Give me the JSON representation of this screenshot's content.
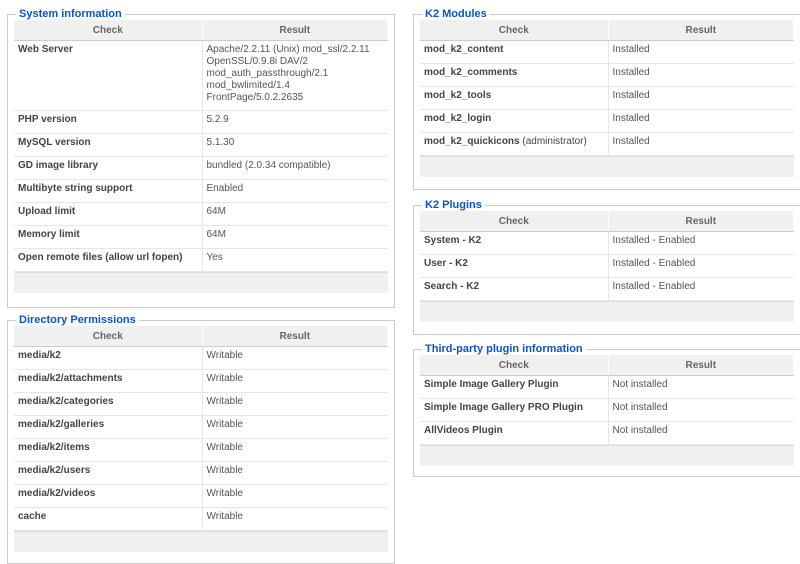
{
  "headers": {
    "check": "Check",
    "result": "Result"
  },
  "system": {
    "title": "System information",
    "rows": [
      {
        "check": "Web Server",
        "lines": [
          "Apache/2.2.11 (Unix) mod_ssl/2.2.11",
          "OpenSSL/0.9.8i DAV/2",
          "mod_auth_passthrough/2.1",
          "mod_bwlimited/1.4",
          "FrontPage/5.0.2.2635"
        ]
      },
      {
        "check": "PHP version",
        "result": "5.2.9"
      },
      {
        "check": "MySQL version",
        "result": "5.1.30"
      },
      {
        "check": "GD image library",
        "result": "bundled (2.0.34 compatible)"
      },
      {
        "check": "Multibyte string support",
        "result": "Enabled"
      },
      {
        "check": "Upload limit",
        "result": "64M"
      },
      {
        "check": "Memory limit",
        "result": "64M"
      },
      {
        "check": "Open remote files (allow url fopen)",
        "result": "Yes"
      }
    ]
  },
  "directory": {
    "title": "Directory Permissions",
    "rows": [
      {
        "check": "media/k2",
        "result": "Writable"
      },
      {
        "check": "media/k2/attachments",
        "result": "Writable"
      },
      {
        "check": "media/k2/categories",
        "result": "Writable"
      },
      {
        "check": "media/k2/galleries",
        "result": "Writable"
      },
      {
        "check": "media/k2/items",
        "result": "Writable"
      },
      {
        "check": "media/k2/users",
        "result": "Writable"
      },
      {
        "check": "media/k2/videos",
        "result": "Writable"
      },
      {
        "check": "cache",
        "result": "Writable"
      }
    ]
  },
  "modules": {
    "title": "K2 Modules",
    "rows": [
      {
        "check": "mod_k2_content",
        "result": "Installed"
      },
      {
        "check": "mod_k2_comments",
        "result": "Installed"
      },
      {
        "check": "mod_k2_tools",
        "result": "Installed"
      },
      {
        "check": "mod_k2_login",
        "result": "Installed"
      },
      {
        "check": "mod_k2_quickicons",
        "suffix": " (administrator)",
        "result": "Installed"
      }
    ]
  },
  "plugins": {
    "title": "K2 Plugins",
    "rows": [
      {
        "check": "System - K2",
        "result": "Installed - Enabled"
      },
      {
        "check": "User - K2",
        "result": "Installed - Enabled"
      },
      {
        "check": "Search - K2",
        "result": "Installed - Enabled"
      }
    ]
  },
  "thirdparty": {
    "title": "Third-party plugin information",
    "rows": [
      {
        "check": "Simple Image Gallery Plugin",
        "result": "Not installed"
      },
      {
        "check": "Simple Image Gallery PRO Plugin",
        "result": "Not installed"
      },
      {
        "check": "AllVideos Plugin",
        "result": "Not installed"
      }
    ]
  }
}
